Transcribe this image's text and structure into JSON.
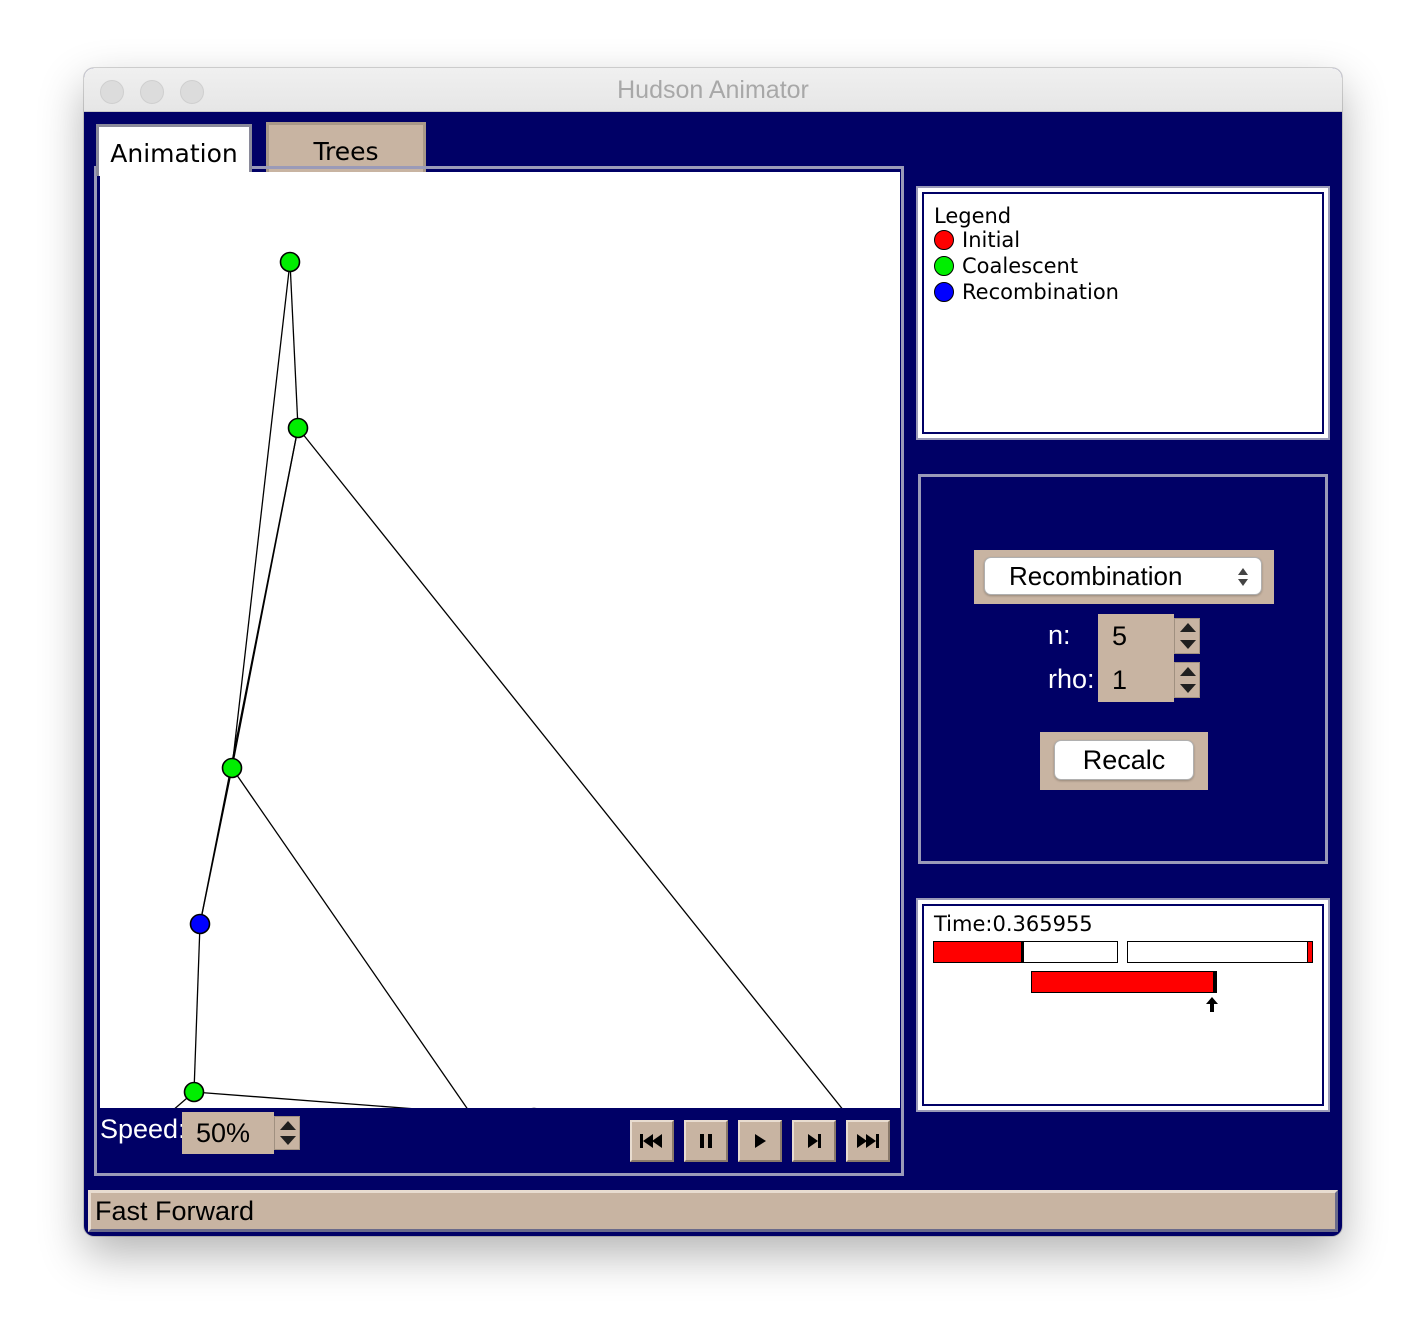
{
  "window": {
    "title": "Hudson Animator"
  },
  "tabs": [
    {
      "label": "Animation",
      "active": true
    },
    {
      "label": "Trees",
      "active": false
    }
  ],
  "animation": {
    "nodes": [
      {
        "id": "c1",
        "type": "coalescent"
      },
      {
        "id": "c2",
        "type": "coalescent"
      },
      {
        "id": "c3",
        "type": "coalescent"
      },
      {
        "id": "r1",
        "type": "recombination"
      },
      {
        "id": "c4",
        "type": "coalescent"
      },
      {
        "id": "c5",
        "type": "coalescent"
      },
      {
        "id": "i1",
        "type": "initial"
      },
      {
        "id": "i2",
        "type": "initial"
      },
      {
        "id": "i3",
        "type": "initial"
      },
      {
        "id": "i4",
        "type": "initial"
      },
      {
        "id": "i5",
        "type": "initial"
      }
    ],
    "edges": [
      [
        "c1",
        "c2"
      ],
      [
        "c1",
        "c3"
      ],
      [
        "c2",
        "c3"
      ],
      [
        "c2",
        "i5"
      ],
      [
        "c3",
        "r1"
      ],
      [
        "c3",
        "i3"
      ],
      [
        "r1",
        "c4"
      ],
      [
        "c4",
        "i1"
      ],
      [
        "c4",
        "c5"
      ],
      [
        "c5",
        "i2"
      ],
      [
        "c5",
        "i4"
      ],
      [
        "c2",
        "r1"
      ]
    ],
    "colors": {
      "initial": "#ff0000",
      "coalescent": "#00ee00",
      "recombination": "#0000ff"
    }
  },
  "speed": {
    "label": "Speed:",
    "value": "50%"
  },
  "playback": {
    "buttons": [
      {
        "name": "rewind",
        "icon": "rewind-icon"
      },
      {
        "name": "pause",
        "icon": "pause-icon"
      },
      {
        "name": "play",
        "icon": "play-icon"
      },
      {
        "name": "step",
        "icon": "step-icon"
      },
      {
        "name": "fast-forward",
        "icon": "fast-forward-icon"
      }
    ]
  },
  "legend": {
    "title": "Legend",
    "items": [
      {
        "label": "Initial",
        "color": "#ff0000"
      },
      {
        "label": "Coalescent",
        "color": "#00ee00"
      },
      {
        "label": "Recombination",
        "color": "#0000ff"
      }
    ]
  },
  "controls": {
    "model": "Recombination",
    "n_label": "n:",
    "n_value": "5",
    "rho_label": "rho:",
    "rho_value": "1",
    "recalc_label": "Recalc"
  },
  "time": {
    "label": "Time:",
    "value": "0.365955",
    "bars": [
      {
        "fill_fraction": 0.49
      },
      {
        "fill_fraction": 0.0
      },
      {
        "fill_fraction": 1.0
      }
    ]
  },
  "status": {
    "text": "Fast Forward"
  },
  "colors": {
    "window_bg": "#000066",
    "widget_tan": "#c8b4a2"
  }
}
